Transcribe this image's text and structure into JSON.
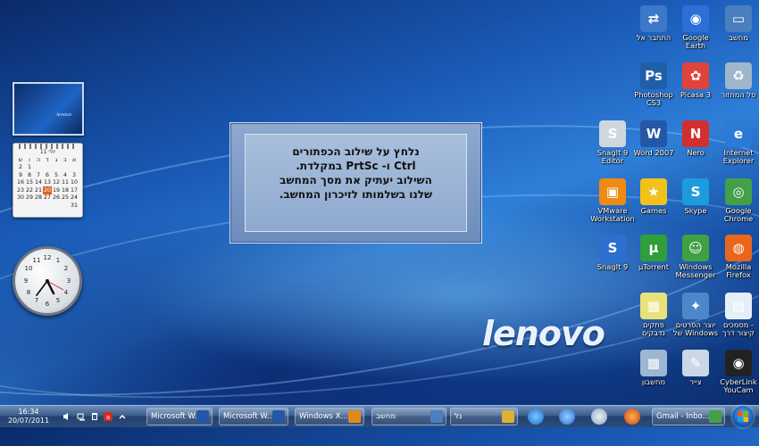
{
  "message": {
    "lines": [
      "נלחץ על שילוב הכפתורים",
      "Ctrl  ו- PrtSc במקלדת.",
      "השילוב יעתיק את מסך המחשב",
      "שלנו בשלמותו לזיכרון המחשב."
    ]
  },
  "brand": {
    "logo_text": "lenovo"
  },
  "gadgets": {
    "calendar": {
      "title": "יולי 11",
      "weekdays": [
        "ש",
        "ו",
        "ה",
        "ד",
        "ג",
        "ב",
        "א"
      ],
      "rows": [
        [
          "2",
          "1",
          "",
          "",
          "",
          "",
          ""
        ],
        [
          "9",
          "8",
          "7",
          "6",
          "5",
          "4",
          "3"
        ],
        [
          "16",
          "15",
          "14",
          "13",
          "12",
          "11",
          "10"
        ],
        [
          "23",
          "22",
          "21",
          "20",
          "19",
          "18",
          "17"
        ],
        [
          "30",
          "29",
          "28",
          "27",
          "26",
          "25",
          "24"
        ],
        [
          "",
          "",
          "",
          "",
          "",
          "",
          "31"
        ]
      ],
      "today": "20"
    },
    "clock": {
      "time": "16:34"
    }
  },
  "icons": [
    {
      "label": "מחשב",
      "name": "computer-icon",
      "color": "#4a7fc0",
      "glyph": "▭"
    },
    {
      "label": "Google Earth",
      "name": "google-earth-icon",
      "color": "#2c6fd6",
      "glyph": "◉"
    },
    {
      "label": "התחבר אל",
      "name": "connect-to-icon",
      "color": "#3b78c9",
      "glyph": "⇄"
    },
    {
      "label": "סל המחזור",
      "name": "recycle-bin-icon",
      "color": "#9fb6cc",
      "glyph": "♻"
    },
    {
      "label": "Picasa 3",
      "name": "picasa-icon",
      "color": "#e0433a",
      "glyph": "✿"
    },
    {
      "label": "Photoshop\nCS3",
      "name": "photoshop-icon",
      "color": "#1f5fa8",
      "glyph": "Ps"
    },
    {
      "label": "Internet\nExplorer",
      "name": "internet-explorer-icon",
      "color": "#2a7ad6",
      "glyph": "e"
    },
    {
      "label": "Nero",
      "name": "nero-icon",
      "color": "#d32f2f",
      "glyph": "N"
    },
    {
      "label": "Word 2007",
      "name": "word-icon",
      "color": "#2457a6",
      "glyph": "W"
    },
    {
      "label": "SnagIt 9\nEditor",
      "name": "snagit-editor-icon",
      "color": "#cfd6de",
      "glyph": "S"
    },
    {
      "label": "Google\nChrome",
      "name": "chrome-icon",
      "color": "#43a047",
      "glyph": "◎"
    },
    {
      "label": "Skype",
      "name": "skype-icon",
      "color": "#1e9bdb",
      "glyph": "S"
    },
    {
      "label": "Games",
      "name": "games-icon",
      "color": "#f2c21a",
      "glyph": "★"
    },
    {
      "label": "VMware\nWorkstation",
      "name": "vmware-icon",
      "color": "#f08a12",
      "glyph": "▣"
    },
    {
      "label": "Mozilla\nFirefox",
      "name": "firefox-icon",
      "color": "#e8661c",
      "glyph": "◍"
    },
    {
      "label": "Windows\nMessenger",
      "name": "windows-messenger-icon",
      "color": "#3fa142",
      "glyph": "☺"
    },
    {
      "label": "µTorrent",
      "name": "utorrent-icon",
      "color": "#2f9e3b",
      "glyph": "µ"
    },
    {
      "label": "SnagIt 9",
      "name": "snagit-icon",
      "color": "#2d6fd0",
      "glyph": "S"
    },
    {
      "label": "מסמכים -\nקיצור דרך",
      "name": "documents-shortcut-icon",
      "color": "#e6eef8",
      "glyph": "▤"
    },
    {
      "label": "יוצר הסרטים\nשל Windows",
      "name": "movie-maker-icon",
      "color": "#4c88c9",
      "glyph": "✦"
    },
    {
      "label": "פתקים\nנדבקים",
      "name": "sticky-notes-icon",
      "color": "#e9e27a",
      "glyph": "▦"
    },
    {
      "label": "CyberLink\nYouCam",
      "name": "youcam-icon",
      "color": "#222",
      "glyph": "◉"
    },
    {
      "label": "צייר",
      "name": "paint-icon",
      "color": "#c9d7e6",
      "glyph": "✎"
    },
    {
      "label": "מחשבון",
      "name": "calculator-icon",
      "color": "#9db6d2",
      "glyph": "▦"
    }
  ],
  "taskbar": {
    "clock_time": "16:34",
    "clock_date": "20/07/2011",
    "buttons": [
      {
        "label": "Microsoft W...",
        "name": "taskbar-word-1"
      },
      {
        "label": "Microsoft W...",
        "name": "taskbar-word-2"
      },
      {
        "label": "Windows X...",
        "name": "taskbar-windows-x"
      },
      {
        "label": "מחשב",
        "name": "taskbar-computer"
      },
      {
        "label": "גל",
        "name": "taskbar-gal"
      },
      {
        "label": "Gmail - Inbo...",
        "name": "taskbar-gmail"
      }
    ]
  }
}
